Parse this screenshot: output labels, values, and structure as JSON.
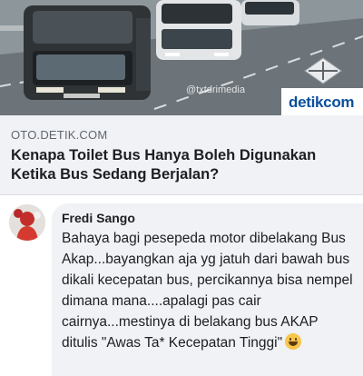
{
  "link_preview": {
    "image_watermark": "@txtdrimedia",
    "brand_logo": "detikcom",
    "domain": "OTO.DETIK.COM",
    "headline": "Kenapa Toilet Bus Hanya Boleh Digunakan Ketika Bus Sedang Berjalan?"
  },
  "comment": {
    "author": "Fredi Sango",
    "text": "Bahaya bagi pesepeda motor dibelakang Bus Akap...bayangkan aja yg jatuh dari bawah bus dikali kecepatan bus, percikannya bisa nempel dimana mana....apalagi pas cair cairnya...mestinya di belakang bus AKAP ditulis \"Awas Ta* Kecepatan Tinggi\"",
    "emoji": "grinning-face-emoji"
  },
  "colors": {
    "background": "#ffffff",
    "card": "#f0f2f5",
    "text": "#1c1e21",
    "muted": "#606770",
    "brand": "#0b4f9c"
  }
}
